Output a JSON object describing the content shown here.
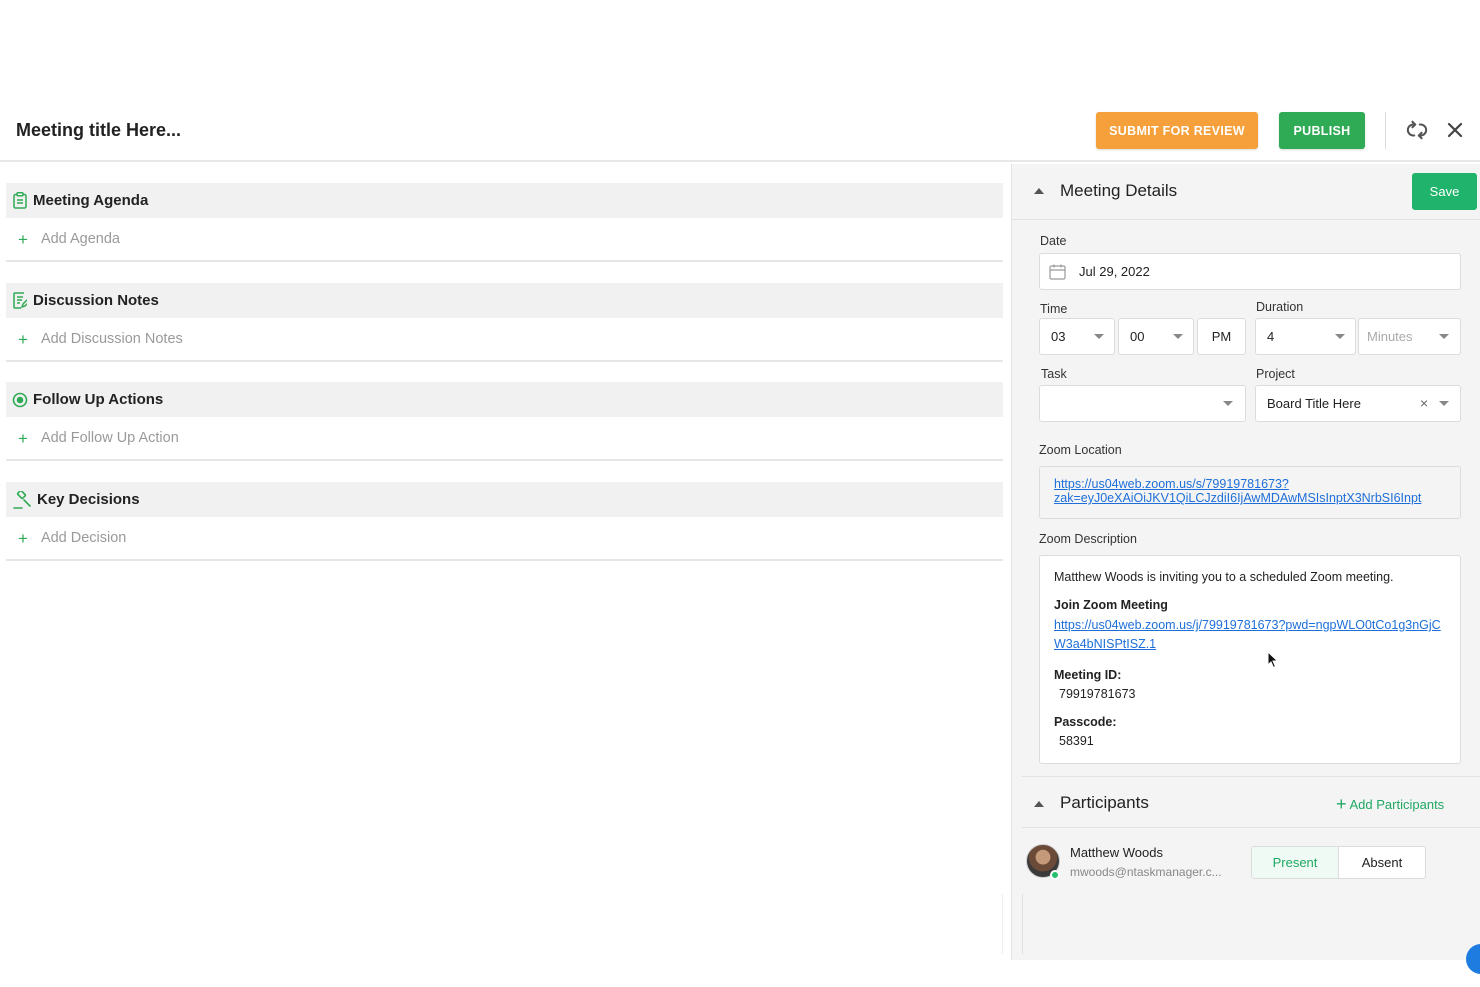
{
  "header": {
    "title": "Meeting title Here...",
    "submit_label": "SUBMIT FOR REVIEW",
    "publish_label": "PUBLISH",
    "review_color": "#f5a03b",
    "publish_color": "#2faa55"
  },
  "sections": [
    {
      "title": "Meeting Agenda",
      "add_label": "Add Agenda",
      "icon": "clipboard-icon"
    },
    {
      "title": "Discussion Notes",
      "add_label": "Add Discussion Notes",
      "icon": "notes-icon"
    },
    {
      "title": "Follow Up Actions",
      "add_label": "Add Follow Up Action",
      "icon": "target-icon"
    },
    {
      "title": "Key Decisions",
      "add_label": "Add Decision",
      "icon": "gavel-icon"
    }
  ],
  "details": {
    "title": "Meeting Details",
    "save_label": "Save",
    "date_label": "Date",
    "date_value": "Jul 29, 2022",
    "time_label": "Time",
    "time_hour": "03",
    "time_minute": "00",
    "time_ampm": "PM",
    "duration_label": "Duration",
    "duration_value": "4",
    "duration_unit_placeholder": "Minutes",
    "task_label": "Task",
    "task_value": "",
    "project_label": "Project",
    "project_value": "Board Title Here",
    "zoom_location_label": "Zoom Location",
    "zoom_location_line1": "https://us04web.zoom.us/s/79919781673?",
    "zoom_location_line2": "zak=eyJ0eXAiOiJKV1QiLCJzdiI6IjAwMDAwMSIsInptX3NrbSI6Inpt",
    "zoom_description_label": "Zoom Description",
    "zoom_invite_text": "Matthew Woods is inviting you to a scheduled Zoom meeting.",
    "join_label": "Join Zoom Meeting",
    "join_link": "https://us04web.zoom.us/j/79919781673?pwd=ngpWLO0tCo1g3nGjCW3a4bNISPtISZ.1",
    "meeting_id_label": "Meeting ID:",
    "meeting_id": "79919781673",
    "passcode_label": "Passcode:",
    "passcode": "58391"
  },
  "participants": {
    "title": "Participants",
    "add_label": "Add Participants",
    "items": [
      {
        "name": "Matthew Woods",
        "email": "mwoods@ntaskmanager.c...",
        "present_label": "Present",
        "absent_label": "Absent"
      }
    ]
  }
}
